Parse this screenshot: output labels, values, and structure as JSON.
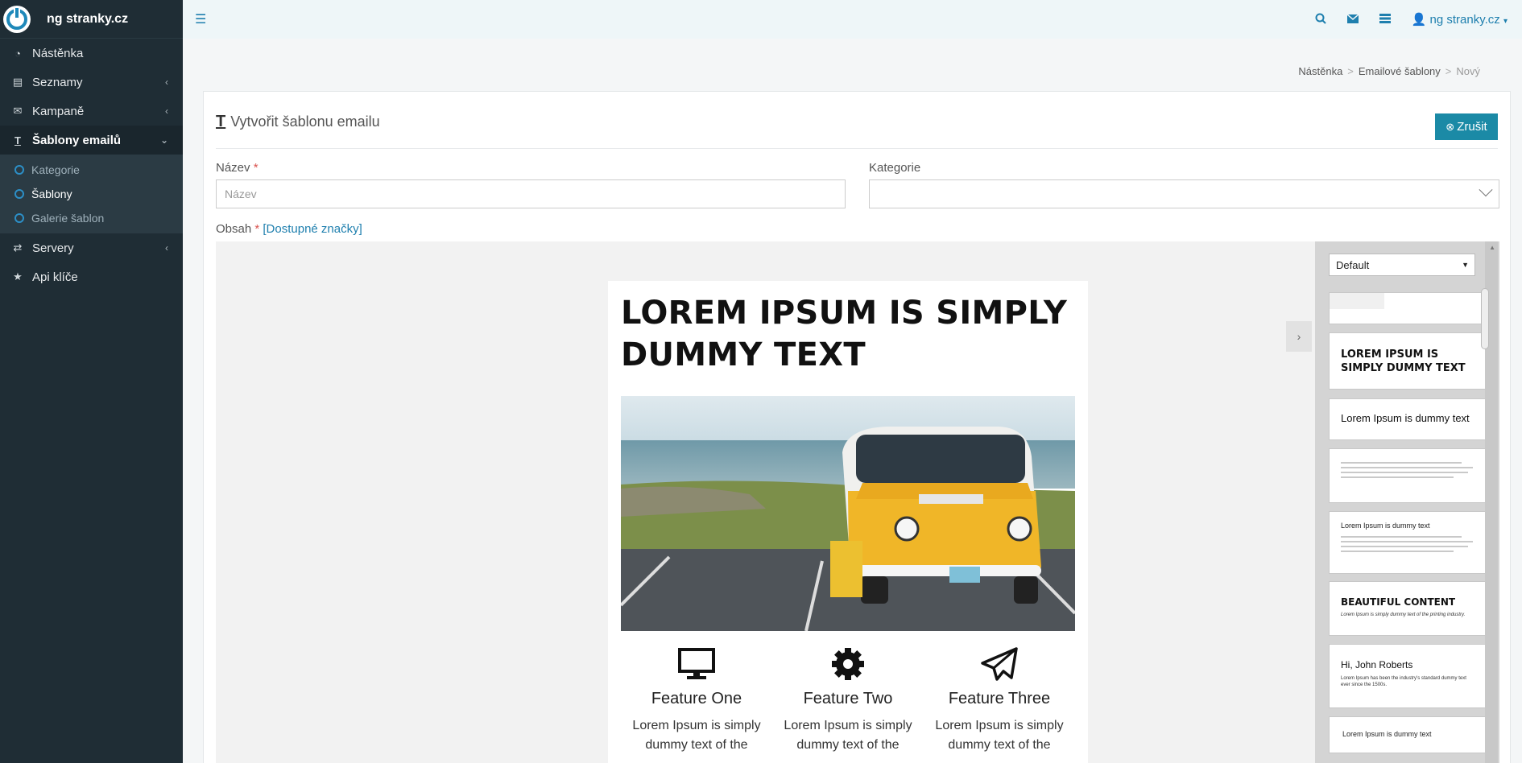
{
  "brand": {
    "name": "ng stranky.cz"
  },
  "sidebar": {
    "items": [
      {
        "label": "Nástěnka",
        "icon": "dashboard-icon"
      },
      {
        "label": "Seznamy",
        "icon": "list-icon"
      },
      {
        "label": "Kampaně",
        "icon": "envelope-icon"
      },
      {
        "label": "Šablony emailů",
        "icon": "text-icon"
      },
      {
        "label": "Servery",
        "icon": "exchange-icon"
      },
      {
        "label": "Api klíče",
        "icon": "star-icon"
      }
    ],
    "subitems": [
      {
        "label": "Kategorie"
      },
      {
        "label": "Šablony"
      },
      {
        "label": "Galerie šablon"
      }
    ]
  },
  "topbar": {
    "user": "ng stranky.cz"
  },
  "breadcrumb": {
    "home": "Nástěnka",
    "section": "Emailové šablony",
    "current": "Nový"
  },
  "form": {
    "title": "Vytvořit šablonu emailu",
    "cancel_label": "Zrušit",
    "name_label": "Název",
    "name_placeholder": "Název",
    "category_label": "Kategorie",
    "content_label": "Obsah",
    "tags_link": "[Dostupné značky]"
  },
  "email": {
    "headline": "LOREM IPSUM IS SIMPLY DUMMY TEXT",
    "features": [
      {
        "title": "Feature One",
        "text": "Lorem Ipsum is simply dummy text of the",
        "icon": "monitor-icon"
      },
      {
        "title": "Feature Two",
        "text": "Lorem Ipsum is simply dummy text of the",
        "icon": "gear-icon"
      },
      {
        "title": "Feature Three",
        "text": "Lorem Ipsum is simply dummy text of the",
        "icon": "paper-plane-icon"
      }
    ]
  },
  "panel": {
    "select_value": "Default",
    "snippets": {
      "big_headline": "LOREM IPSUM IS SIMPLY DUMMY TEXT",
      "medium_text": "Lorem Ipsum is dummy text",
      "title_small": "Lorem Ipsum is dummy text",
      "beautiful": "BEAUTIFUL CONTENT",
      "beautiful_sub": "Lorem Ipsum is simply dummy text of the printing industry.",
      "greeting": "Hi, John Roberts",
      "greeting_sub": "Lorem Ipsum has been the industry's standard dummy text ever since the 1500s.",
      "last": "Lorem Ipsum is dummy text"
    }
  }
}
